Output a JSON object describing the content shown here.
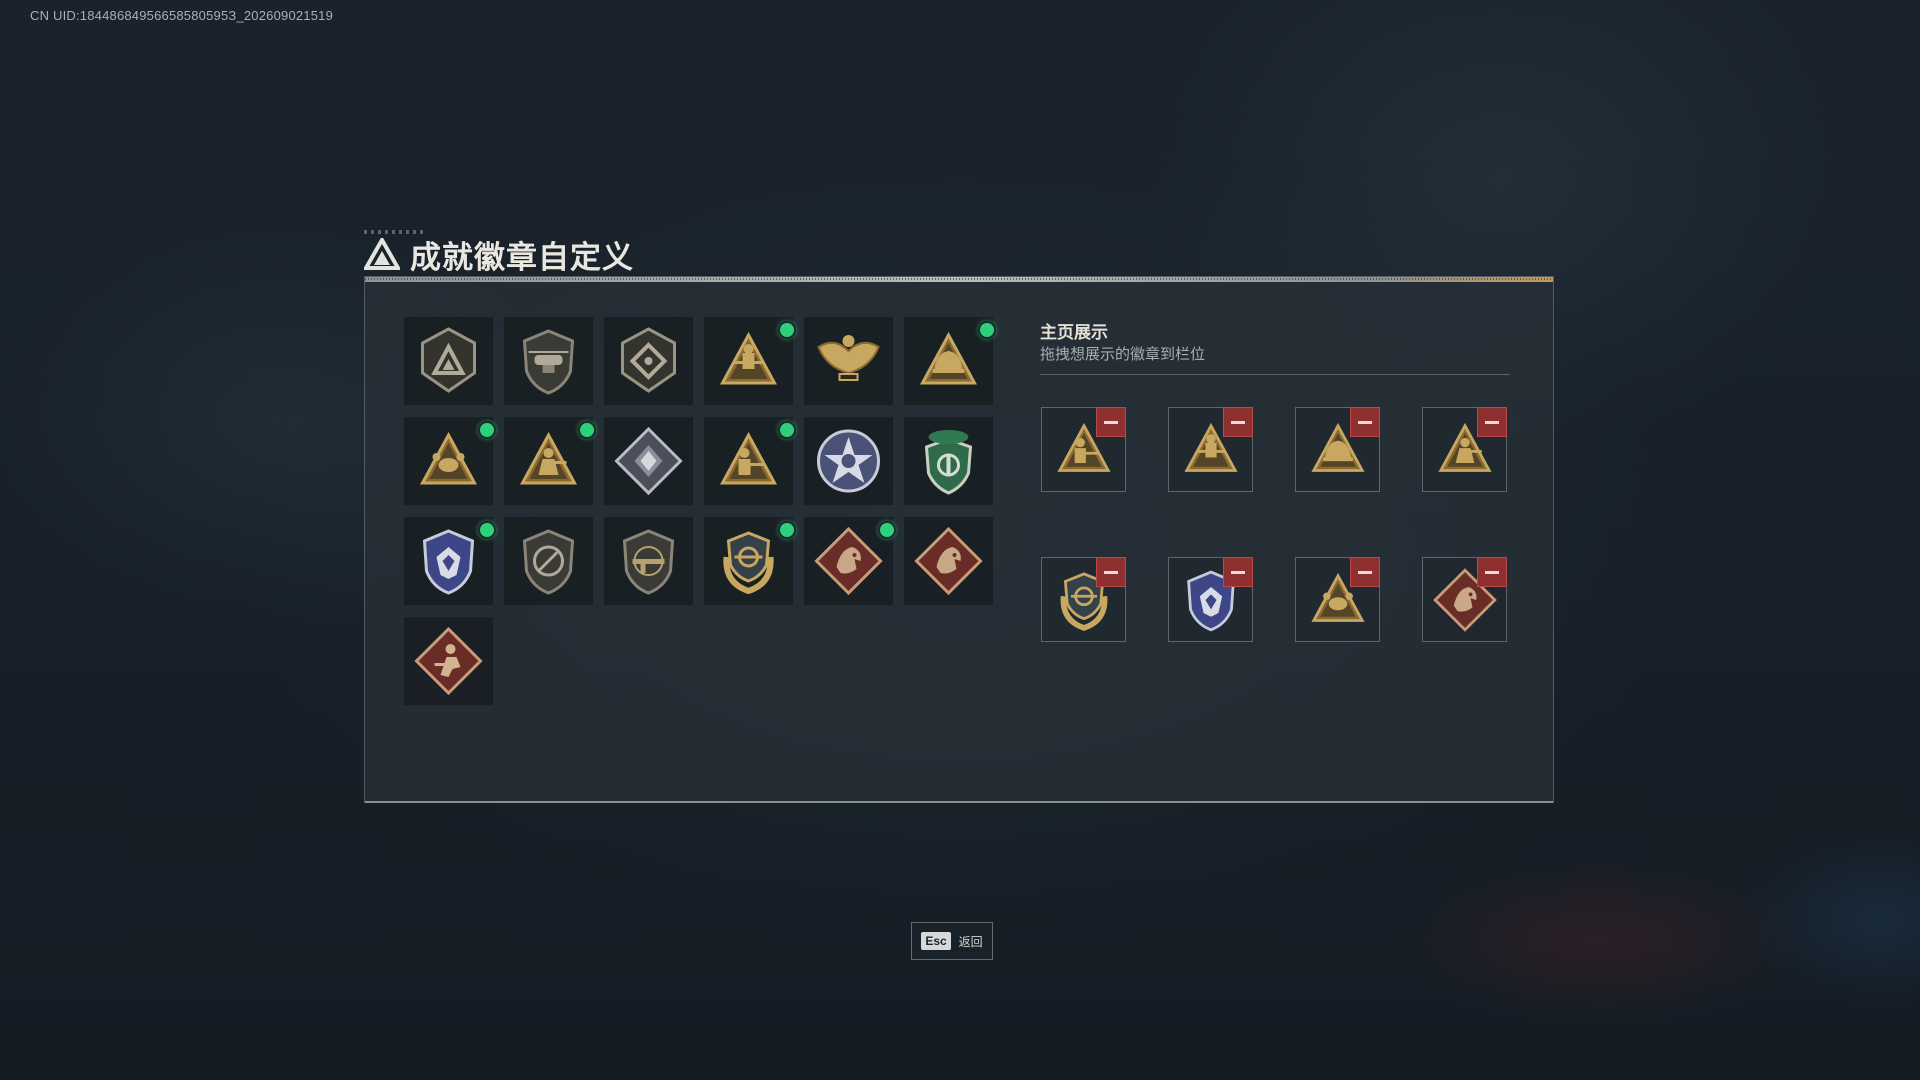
{
  "uid_text": "CN UID:18448684956658580595З_202609021519",
  "title": "成就徽章自定义",
  "title_icon": "delta-triangle-logo-icon",
  "colors": {
    "accent_gold": "#c8a860",
    "new_dot": "#2fd07c",
    "remove": "#8e2f30"
  },
  "badge_grid": [
    {
      "icon": "delta-shield-badge-icon",
      "new": false
    },
    {
      "icon": "helicopter-shield-badge-icon",
      "new": false
    },
    {
      "icon": "chevron-shield-badge-icon",
      "new": false
    },
    {
      "icon": "gold-soldier-triangle-badge-icon",
      "new": true
    },
    {
      "icon": "gold-eagle-badge-icon",
      "new": false
    },
    {
      "icon": "gold-helmet-triangle-badge-icon",
      "new": true
    },
    {
      "icon": "gold-crab-triangle-badge-icon",
      "new": true
    },
    {
      "icon": "gold-raider-triangle-badge-icon",
      "new": true
    },
    {
      "icon": "silver-diamond-badge-icon",
      "new": false
    },
    {
      "icon": "gold-gunner-triangle-badge-icon",
      "new": true
    },
    {
      "icon": "star-skull-badge-icon",
      "new": false
    },
    {
      "icon": "green-beret-shield-badge-icon",
      "new": false
    },
    {
      "icon": "blue-wolf-shield-badge-icon",
      "new": true
    },
    {
      "icon": "no-rifle-shield-badge-icon",
      "new": false
    },
    {
      "icon": "rifle-shield-badge-icon",
      "new": false
    },
    {
      "icon": "gold-wreath-crest-badge-icon",
      "new": true
    },
    {
      "icon": "red-dragon-diamond-badge-icon",
      "new": true
    },
    {
      "icon": "red-dragon-diamond-badge-icon",
      "new": false
    },
    {
      "icon": "red-soldier-diamond-badge-icon",
      "new": false
    }
  ],
  "showcase": {
    "title": "主页展示",
    "subtitle": "拖拽想展示的徽章到栏位",
    "slots": [
      {
        "icon": "gold-gunner-triangle-badge-icon"
      },
      {
        "icon": "gold-soldier-triangle-badge-icon"
      },
      {
        "icon": "gold-helmet-triangle-badge-icon"
      },
      {
        "icon": "gold-raider-triangle-badge-icon"
      },
      {
        "icon": "gold-wreath-crest-badge-icon"
      },
      {
        "icon": "blue-wolf-shield-badge-icon"
      },
      {
        "icon": "gold-crab-triangle-badge-icon"
      },
      {
        "icon": "red-dragon-diamond-badge-icon"
      }
    ]
  },
  "footer": {
    "esc_key": "Esc",
    "esc_label": "返回"
  }
}
